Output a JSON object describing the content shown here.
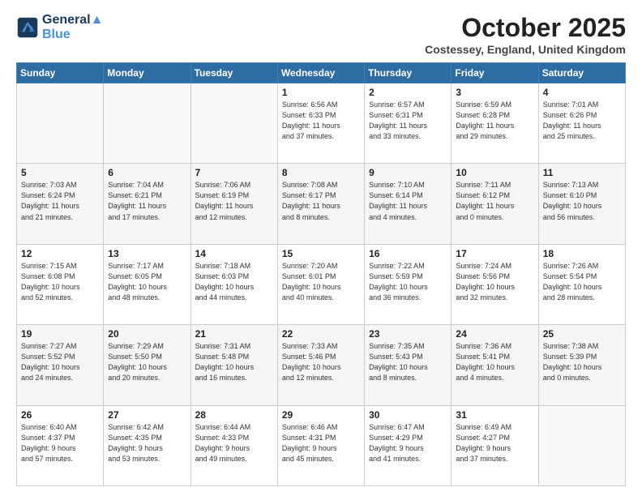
{
  "header": {
    "logo_line1": "General",
    "logo_line2": "Blue",
    "title": "October 2025",
    "location": "Costessey, England, United Kingdom"
  },
  "weekdays": [
    "Sunday",
    "Monday",
    "Tuesday",
    "Wednesday",
    "Thursday",
    "Friday",
    "Saturday"
  ],
  "weeks": [
    [
      {
        "day": "",
        "info": ""
      },
      {
        "day": "",
        "info": ""
      },
      {
        "day": "",
        "info": ""
      },
      {
        "day": "1",
        "info": "Sunrise: 6:56 AM\nSunset: 6:33 PM\nDaylight: 11 hours\nand 37 minutes."
      },
      {
        "day": "2",
        "info": "Sunrise: 6:57 AM\nSunset: 6:31 PM\nDaylight: 11 hours\nand 33 minutes."
      },
      {
        "day": "3",
        "info": "Sunrise: 6:59 AM\nSunset: 6:28 PM\nDaylight: 11 hours\nand 29 minutes."
      },
      {
        "day": "4",
        "info": "Sunrise: 7:01 AM\nSunset: 6:26 PM\nDaylight: 11 hours\nand 25 minutes."
      }
    ],
    [
      {
        "day": "5",
        "info": "Sunrise: 7:03 AM\nSunset: 6:24 PM\nDaylight: 11 hours\nand 21 minutes."
      },
      {
        "day": "6",
        "info": "Sunrise: 7:04 AM\nSunset: 6:21 PM\nDaylight: 11 hours\nand 17 minutes."
      },
      {
        "day": "7",
        "info": "Sunrise: 7:06 AM\nSunset: 6:19 PM\nDaylight: 11 hours\nand 12 minutes."
      },
      {
        "day": "8",
        "info": "Sunrise: 7:08 AM\nSunset: 6:17 PM\nDaylight: 11 hours\nand 8 minutes."
      },
      {
        "day": "9",
        "info": "Sunrise: 7:10 AM\nSunset: 6:14 PM\nDaylight: 11 hours\nand 4 minutes."
      },
      {
        "day": "10",
        "info": "Sunrise: 7:11 AM\nSunset: 6:12 PM\nDaylight: 11 hours\nand 0 minutes."
      },
      {
        "day": "11",
        "info": "Sunrise: 7:13 AM\nSunset: 6:10 PM\nDaylight: 10 hours\nand 56 minutes."
      }
    ],
    [
      {
        "day": "12",
        "info": "Sunrise: 7:15 AM\nSunset: 6:08 PM\nDaylight: 10 hours\nand 52 minutes."
      },
      {
        "day": "13",
        "info": "Sunrise: 7:17 AM\nSunset: 6:05 PM\nDaylight: 10 hours\nand 48 minutes."
      },
      {
        "day": "14",
        "info": "Sunrise: 7:18 AM\nSunset: 6:03 PM\nDaylight: 10 hours\nand 44 minutes."
      },
      {
        "day": "15",
        "info": "Sunrise: 7:20 AM\nSunset: 6:01 PM\nDaylight: 10 hours\nand 40 minutes."
      },
      {
        "day": "16",
        "info": "Sunrise: 7:22 AM\nSunset: 5:59 PM\nDaylight: 10 hours\nand 36 minutes."
      },
      {
        "day": "17",
        "info": "Sunrise: 7:24 AM\nSunset: 5:56 PM\nDaylight: 10 hours\nand 32 minutes."
      },
      {
        "day": "18",
        "info": "Sunrise: 7:26 AM\nSunset: 5:54 PM\nDaylight: 10 hours\nand 28 minutes."
      }
    ],
    [
      {
        "day": "19",
        "info": "Sunrise: 7:27 AM\nSunset: 5:52 PM\nDaylight: 10 hours\nand 24 minutes."
      },
      {
        "day": "20",
        "info": "Sunrise: 7:29 AM\nSunset: 5:50 PM\nDaylight: 10 hours\nand 20 minutes."
      },
      {
        "day": "21",
        "info": "Sunrise: 7:31 AM\nSunset: 5:48 PM\nDaylight: 10 hours\nand 16 minutes."
      },
      {
        "day": "22",
        "info": "Sunrise: 7:33 AM\nSunset: 5:46 PM\nDaylight: 10 hours\nand 12 minutes."
      },
      {
        "day": "23",
        "info": "Sunrise: 7:35 AM\nSunset: 5:43 PM\nDaylight: 10 hours\nand 8 minutes."
      },
      {
        "day": "24",
        "info": "Sunrise: 7:36 AM\nSunset: 5:41 PM\nDaylight: 10 hours\nand 4 minutes."
      },
      {
        "day": "25",
        "info": "Sunrise: 7:38 AM\nSunset: 5:39 PM\nDaylight: 10 hours\nand 0 minutes."
      }
    ],
    [
      {
        "day": "26",
        "info": "Sunrise: 6:40 AM\nSunset: 4:37 PM\nDaylight: 9 hours\nand 57 minutes."
      },
      {
        "day": "27",
        "info": "Sunrise: 6:42 AM\nSunset: 4:35 PM\nDaylight: 9 hours\nand 53 minutes."
      },
      {
        "day": "28",
        "info": "Sunrise: 6:44 AM\nSunset: 4:33 PM\nDaylight: 9 hours\nand 49 minutes."
      },
      {
        "day": "29",
        "info": "Sunrise: 6:46 AM\nSunset: 4:31 PM\nDaylight: 9 hours\nand 45 minutes."
      },
      {
        "day": "30",
        "info": "Sunrise: 6:47 AM\nSunset: 4:29 PM\nDaylight: 9 hours\nand 41 minutes."
      },
      {
        "day": "31",
        "info": "Sunrise: 6:49 AM\nSunset: 4:27 PM\nDaylight: 9 hours\nand 37 minutes."
      },
      {
        "day": "",
        "info": ""
      }
    ]
  ]
}
